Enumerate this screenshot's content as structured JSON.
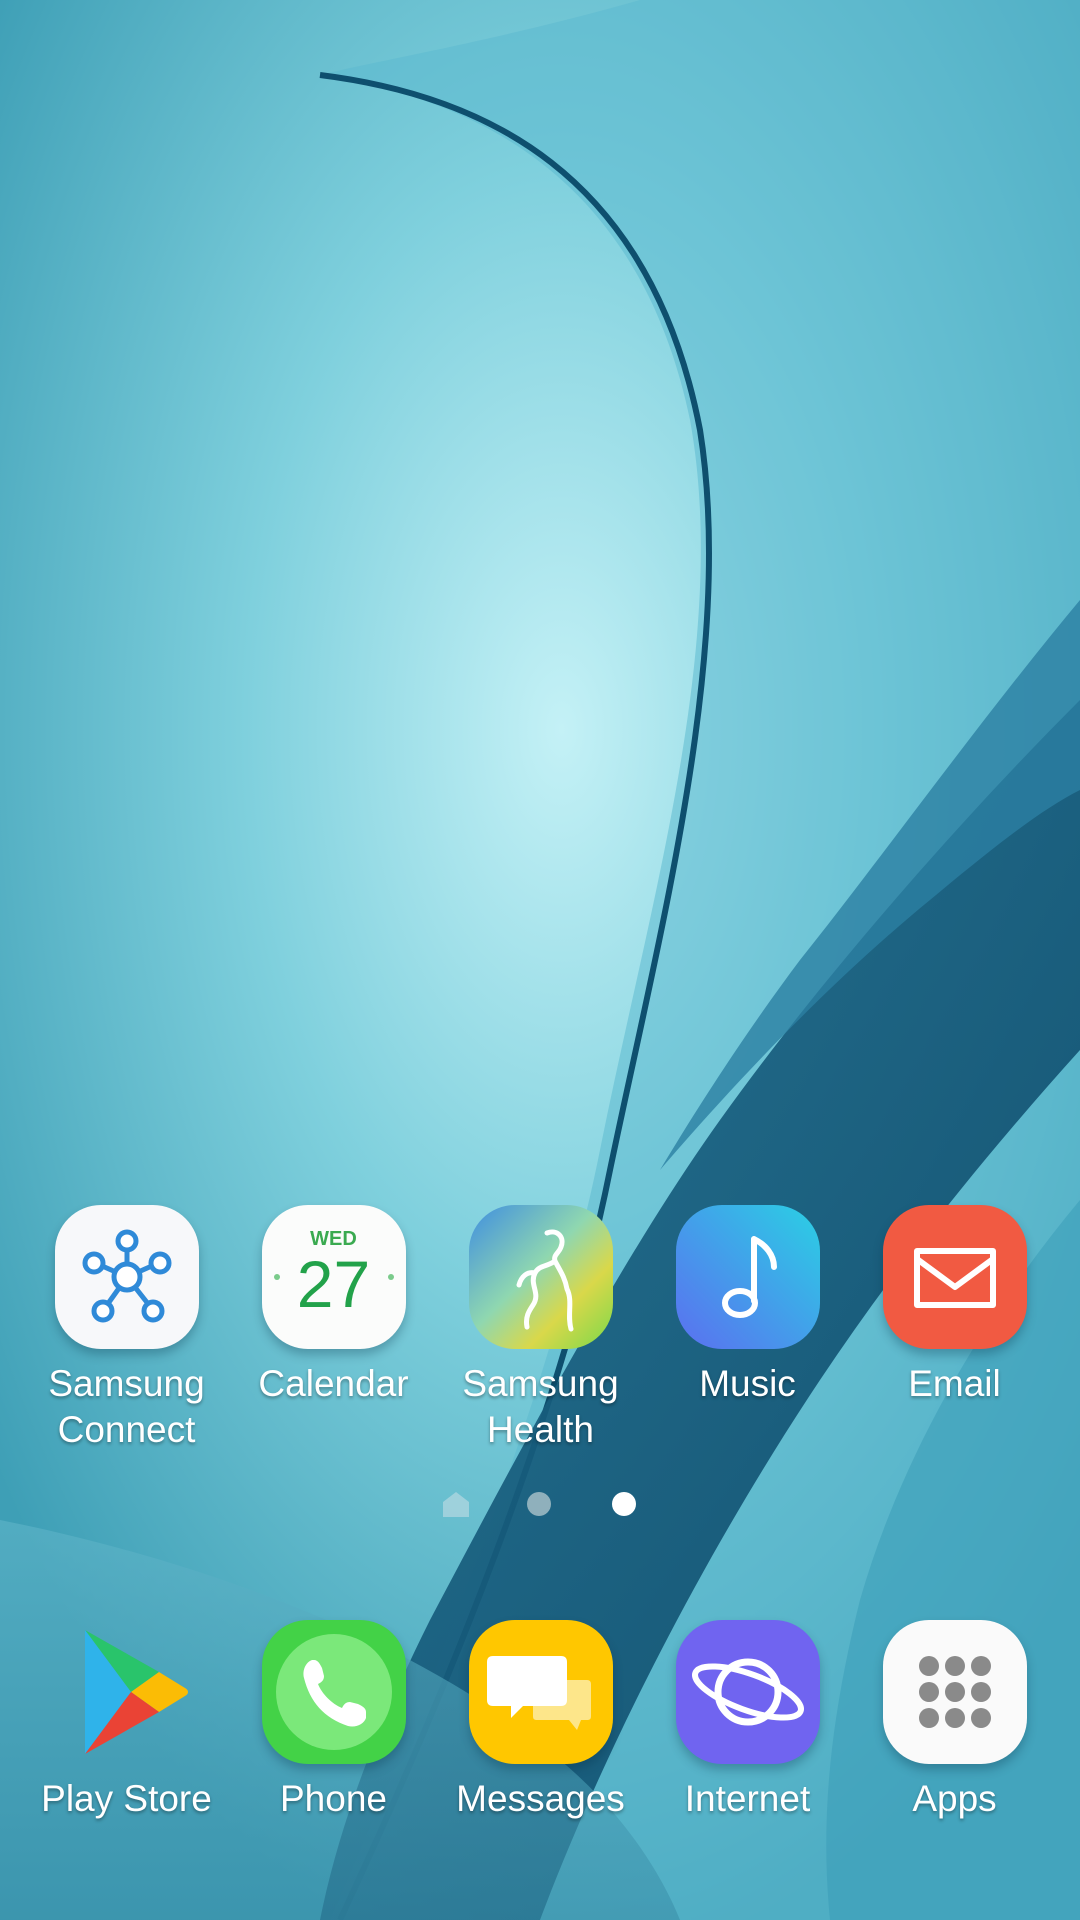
{
  "home_apps": [
    {
      "label": "Samsung\nConnect",
      "icon": "samsung-connect-icon"
    },
    {
      "label": "Calendar",
      "icon": "calendar-icon",
      "weekday": "WED",
      "day": "27"
    },
    {
      "label": "Samsung\nHealth",
      "icon": "samsung-health-icon"
    },
    {
      "label": "Music",
      "icon": "music-note-icon"
    },
    {
      "label": "Email",
      "icon": "email-envelope-icon"
    }
  ],
  "page_indicator": {
    "pages": [
      "home",
      "page-2",
      "page-3"
    ],
    "active_index": 2
  },
  "dock_apps": [
    {
      "label": "Play Store",
      "icon": "play-store-icon"
    },
    {
      "label": "Phone",
      "icon": "phone-handset-icon"
    },
    {
      "label": "Messages",
      "icon": "chat-bubbles-icon"
    },
    {
      "label": "Internet",
      "icon": "planet-icon"
    },
    {
      "label": "Apps",
      "icon": "app-grid-icon"
    }
  ],
  "colors": {
    "wallpaper_base": "#4aa9bf",
    "email_red": "#f15a42",
    "phone_green": "#4cd964",
    "messages_yellow": "#ffc700",
    "internet_purple": "#7064f0"
  }
}
